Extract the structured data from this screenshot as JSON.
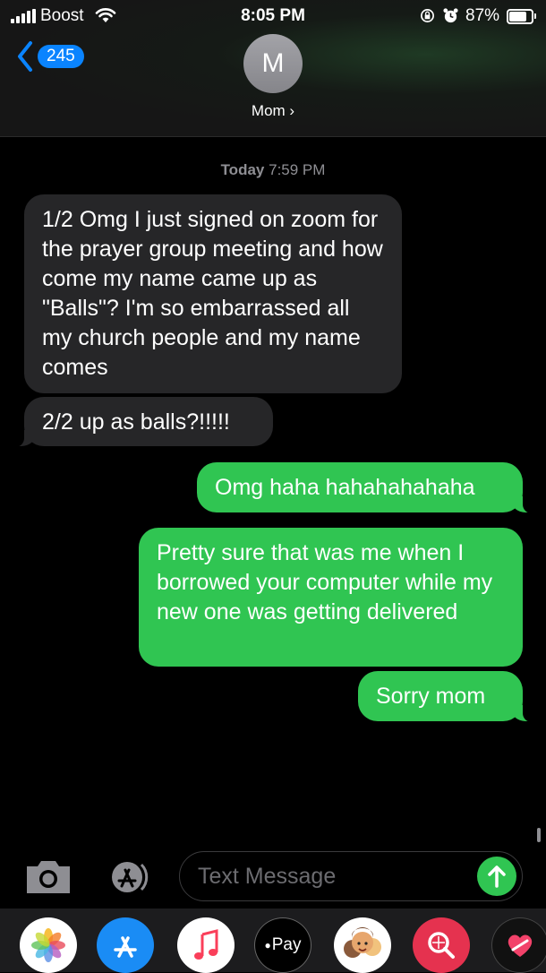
{
  "status": {
    "carrier": "Boost",
    "time": "8:05 PM",
    "battery": "87%",
    "battery_level": 0.87
  },
  "nav": {
    "unread_count": "245",
    "avatar_initial": "M",
    "contact_name": "Mom ›"
  },
  "thread": {
    "timestamp_day": "Today",
    "timestamp_time": "7:59 PM",
    "messages": [
      {
        "direction": "incoming",
        "text": "1/2 Omg I just signed on zoom for the prayer group meeting and how come my name came up as \"Balls\"? I'm so embarrassed all my church people and my name comes"
      },
      {
        "direction": "incoming",
        "text": "2/2  up as balls?!!!!!"
      },
      {
        "direction": "outgoing",
        "text": "Omg haha hahahahahaha"
      },
      {
        "direction": "outgoing",
        "text": "Pretty sure that was me when I borrowed your computer while my new one was getting delivered"
      },
      {
        "direction": "outgoing",
        "text": "Sorry mom"
      }
    ]
  },
  "composer": {
    "placeholder": "Text Message"
  },
  "dock": {
    "apps": [
      "photos-icon",
      "app-store-icon",
      "music-icon",
      "apple-pay-icon",
      "memoji-icon",
      "web-search-icon",
      "digital-touch-icon"
    ],
    "apple_pay_label": "Pay"
  },
  "colors": {
    "incoming": "#262628",
    "outgoing": "#30c552",
    "accent": "#0a84ff"
  }
}
